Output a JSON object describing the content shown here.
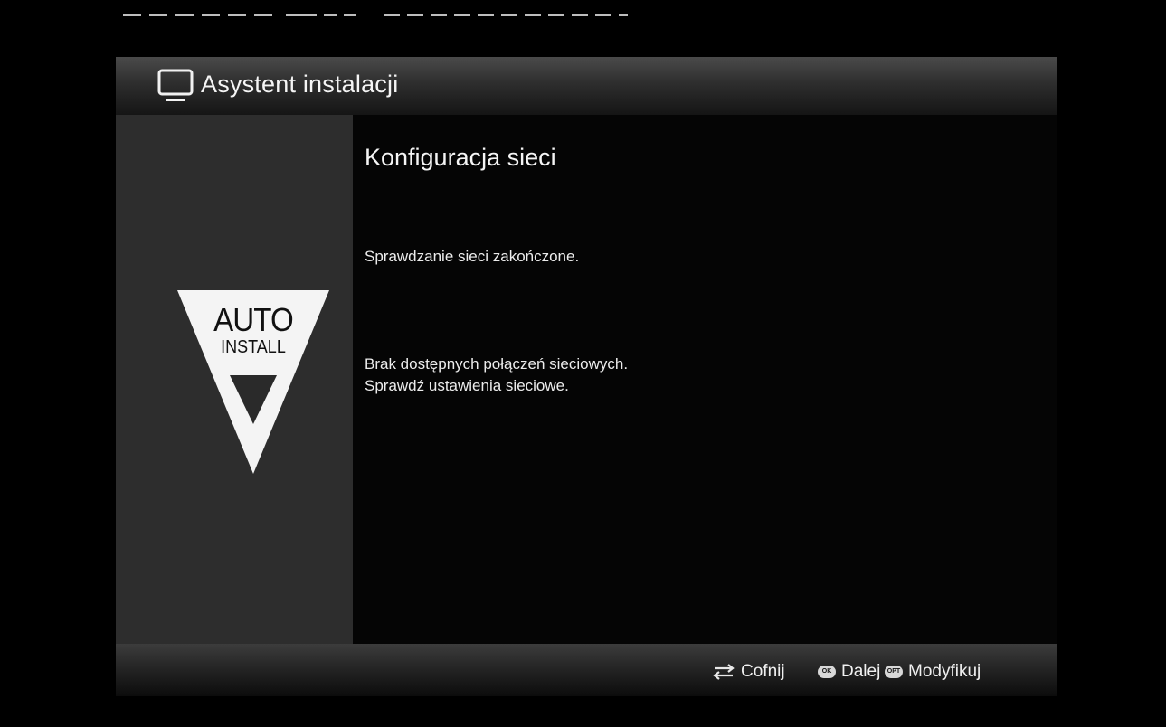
{
  "header": {
    "title": "Asystent instalacji",
    "icon": "tv-icon"
  },
  "sidebar": {
    "logo": {
      "line1": "AUTO",
      "line2": "INSTALL",
      "icon": "auto-install-logo-icon"
    }
  },
  "content": {
    "title": "Konfiguracja sieci",
    "status": "Sprawdzanie sieci zakończone.",
    "message_line1": "Brak dostępnych połączeń sieciowych.",
    "message_line2": "Sprawdź ustawienia sieciowe."
  },
  "footer": {
    "back": {
      "icon": "back-arrows-icon",
      "label": "Cofnij"
    },
    "ok": {
      "key": "OK",
      "label": "Dalej"
    },
    "opt": {
      "key": "OPT",
      "label": "Modyfikuj"
    }
  },
  "colors": {
    "panel": "#2d2d2d",
    "background": "#000000",
    "text": "#f2f2f2"
  }
}
